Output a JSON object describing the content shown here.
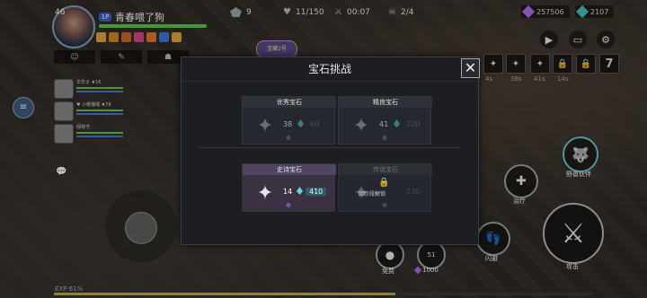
{
  "player": {
    "level": "46",
    "badge": "1P",
    "name": "青春喂了狗"
  },
  "top_stats": {
    "s1": "9",
    "s2": "11/150",
    "s3": "00:07",
    "s4": "2/4"
  },
  "currency": {
    "purple": "257506",
    "teal": "2107"
  },
  "banner": "宝藏2号",
  "party": [
    {
      "name": "华华子 ♦16"
    },
    {
      "name": "♥ 小暖猫嘿 ♦78"
    },
    {
      "name": "绿林守"
    }
  ],
  "skills_top": [
    "✦",
    "✦",
    "✦",
    "🔒",
    "🔒",
    "7"
  ],
  "skill_timers": [
    "4s",
    "38s",
    "41s",
    "14s"
  ],
  "right_buttons": {
    "beast": "野兽伙伴",
    "heal": "治疗",
    "dodge": "闪避",
    "attack": "攻击"
  },
  "bottom_items": {
    "free": "免费",
    "count": "51",
    "cost": "1000"
  },
  "exp": "EXP 61%",
  "modal": {
    "title": "宝石挑战",
    "cards": [
      {
        "header": "优秀宝石",
        "count": "38",
        "cost": "60"
      },
      {
        "header": "精良宝石",
        "count": "41",
        "cost": "220"
      },
      {
        "header": "史诗宝石",
        "count": "14",
        "cost": "410"
      },
      {
        "header": "传说宝石",
        "count": "",
        "cost": "530",
        "lock_text": "四阶段解锁"
      }
    ]
  }
}
